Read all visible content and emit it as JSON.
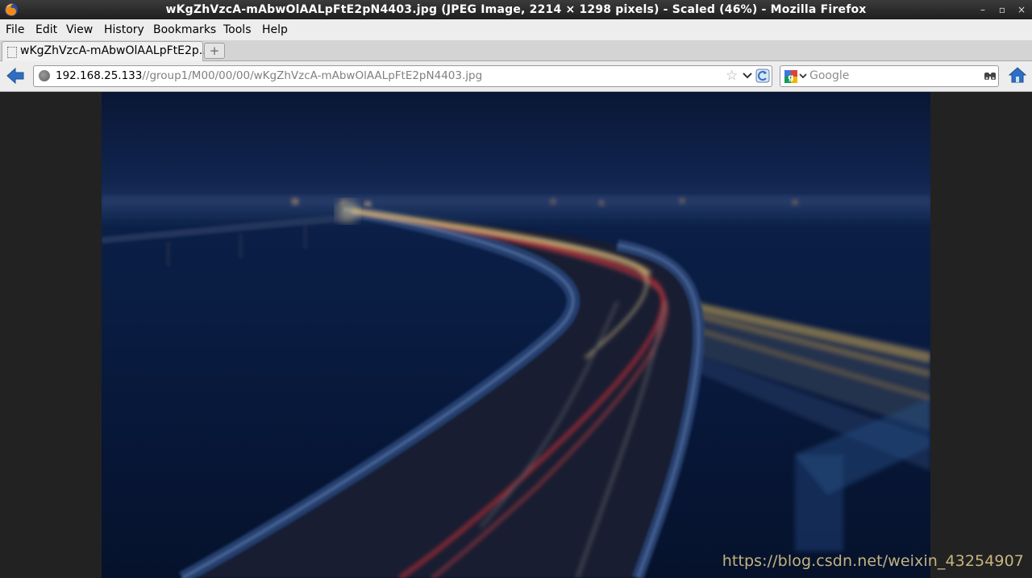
{
  "window": {
    "title": "wKgZhVzcA-mAbwOlAALpFtE2pN4403.jpg (JPEG Image, 2214 × 1298 pixels) - Scaled (46%) - Mozilla Firefox",
    "minimize": "–",
    "maximize": "▫",
    "close": "×"
  },
  "menu": {
    "items": [
      {
        "label": "File"
      },
      {
        "label": "Edit"
      },
      {
        "label": "View"
      },
      {
        "label": "History"
      },
      {
        "label": "Bookmarks"
      },
      {
        "label": "Tools"
      },
      {
        "label": "Help"
      }
    ]
  },
  "tabs": {
    "active_label": "wKgZhVzcA-mAbwOlAALpFtE2p...",
    "new_tab_label": "+"
  },
  "navbar": {
    "url_host": "192.168.25.133",
    "url_path": "//group1/M00/00/00/wKgZhVzcA-mAbwOlAALpFtE2pN4403.jpg",
    "search_placeholder": "Google",
    "icons": [
      "back-arrow-icon",
      "site-identity-icon",
      "bookmark-star-icon",
      "dropdown-icon",
      "reload-icon",
      "google-icon",
      "search-icon",
      "home-icon"
    ]
  },
  "content": {
    "image_description_icon": "night-highway-bridge-photo",
    "watermark": "https://blog.csdn.net/weixin_43254907"
  }
}
